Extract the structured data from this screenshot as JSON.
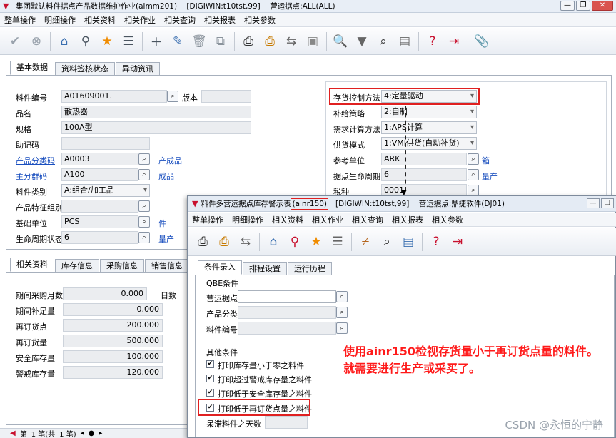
{
  "window": {
    "title": "集团默认料件据点产品数据维护作业(aimm201)    [DIGIWIN:t10tst,99]    营运据点:ALL(ALL)",
    "buttons": {
      "minimize": "—",
      "restore": "❐",
      "close": "✕"
    }
  },
  "menu": [
    "整单操作",
    "明细操作",
    "相关资料",
    "相关作业",
    "相关查询",
    "相关报表",
    "相关参数"
  ],
  "tabs_top": [
    "基本数据",
    "资料签核状态",
    "异动资讯"
  ],
  "basic": {
    "item_no_label": "料件编号",
    "item_no": "A01609001.",
    "version_label": "版本",
    "version": "",
    "name_label": "品名",
    "name": "散热器",
    "spec_label": "规格",
    "spec": "100A型",
    "mnemonic_label": "助记码",
    "mnemonic": "",
    "product_class_label": "产品分类码",
    "product_class": "A0003",
    "product_class_desc": "产成品",
    "main_group_label": "主分群码",
    "main_group": "A100",
    "main_group_desc": "成品",
    "item_type_label": "料件类别",
    "item_type": "A:组合/加工品",
    "feature_group_label": "产品特征组别",
    "feature_group": "",
    "base_unit_label": "基础单位",
    "base_unit": "PCS",
    "base_unit_desc": "件",
    "lifecycle_label": "生命周期状态",
    "lifecycle": "6",
    "lifecycle_desc": "量产"
  },
  "right": {
    "inventory_control_label": "存货控制方法",
    "inventory_control": "4:定量驱动",
    "replenish_label": "补给策略",
    "replenish": "2:自制",
    "demand_calc_label": "需求计算方法",
    "demand_calc": "1:APS计算",
    "supply_mode_label": "供货模式",
    "supply_mode": "1:VMI供货(自动补货)",
    "ref_unit_label": "参考单位",
    "ref_unit": "ARK",
    "ref_unit_desc": "箱",
    "site_lifecycle_label": "据点生命周期",
    "site_lifecycle": "6",
    "site_lifecycle_desc": "量产",
    "tax_label": "税种",
    "tax": "0001"
  },
  "tabs_bottom": [
    "相关资料",
    "库存信息",
    "采购信息",
    "销售信息"
  ],
  "related": {
    "purchase_period_label": "期间采购月数",
    "purchase_period": "0.000",
    "days_label": "日数",
    "period_replenish_label": "期间补足量",
    "period_replenish": "0.000",
    "reorder_point_label": "再订货点",
    "reorder_point": "200.000",
    "reorder_qty_label": "再订货量",
    "reorder_qty": "500.000",
    "safety_stock_label": "安全库存量",
    "safety_stock": "100.000",
    "alert_stock_label": "警戒库存量",
    "alert_stock": "120.000"
  },
  "pager": {
    "first": "第",
    "record": "1 笔(共",
    "total": "1 笔)"
  },
  "child": {
    "title_prefix": "料件多营运据点库存警示表",
    "title_code": "(ainr150)",
    "title_rest": "[DIGIWIN:t10tst,99]    营运据点:鼎捷软件(DJ01)",
    "menu": [
      "整单操作",
      "明细操作",
      "相关资料",
      "相关作业",
      "相关查询",
      "相关报表",
      "相关参数"
    ],
    "tabs": [
      "条件录入",
      "排程设置",
      "运行历程"
    ],
    "qbe_label": "QBE条件",
    "site_label": "营运据点",
    "site": "",
    "class_label": "产品分类",
    "class": "",
    "item_label": "料件编号",
    "item": "",
    "other_label": "其他条件",
    "checks": [
      {
        "label": "打印库存量小于零之料件",
        "checked": true
      },
      {
        "label": "打印超过警戒库存量之料件",
        "checked": true
      },
      {
        "label": "打印低于安全库存量之料件",
        "checked": true
      },
      {
        "label": "打印低于再订货点量之料件",
        "checked": true
      }
    ],
    "stagnant_label": "呆滞料件之天数",
    "stagnant": ""
  },
  "annotation": "使用ainr150检视存货量小于再订货点量的料件。就需要进行生产或采买了。",
  "watermark": "CSDN @永恒的宁静",
  "icons": {
    "confirm": "check-circle-icon",
    "cancel": "x-circle-icon",
    "home": "home-icon",
    "pin": "map-pin-icon",
    "star": "star-icon",
    "list": "list-icon",
    "add": "add-icon",
    "edit": "pencil-icon",
    "delete": "trash-icon",
    "copy": "copy-icon",
    "print": "printer-icon",
    "search": "search-icon",
    "filter": "filter-icon",
    "help": "help-icon",
    "exit": "exit-icon",
    "attach": "paperclip-icon"
  }
}
